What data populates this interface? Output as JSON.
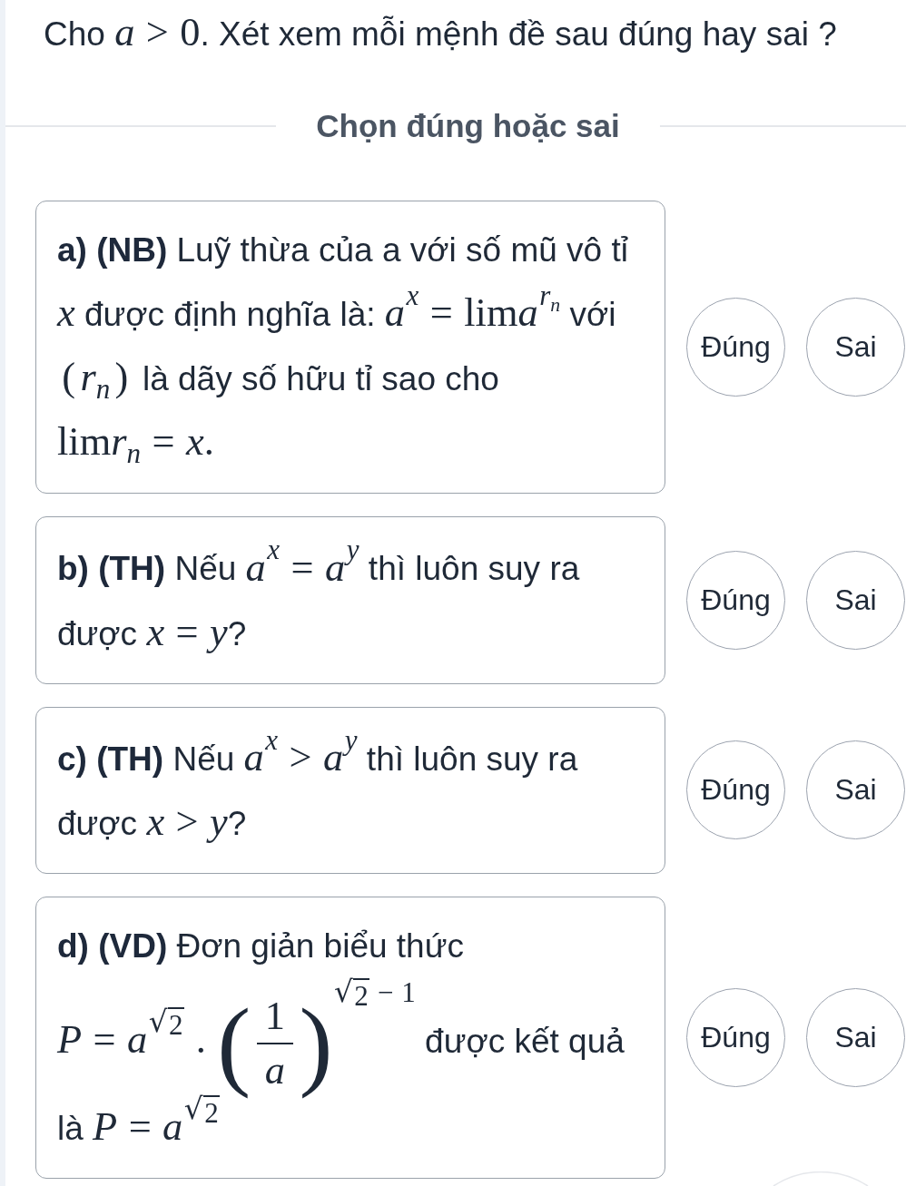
{
  "question": {
    "segments": [
      {
        "kind": "text",
        "text": "Cho "
      },
      {
        "kind": "math",
        "nodes": [
          {
            "kind": "var",
            "text": "a"
          },
          {
            "kind": "rel",
            "text": ">"
          },
          {
            "kind": "text",
            "text": "0"
          }
        ]
      },
      {
        "kind": "text",
        "text": ". Xét xem mỗi mệnh đề sau đúng hay sai ?"
      }
    ]
  },
  "instruction": "Chọn đúng hoặc sai",
  "statements": [
    {
      "segments": [
        {
          "kind": "label",
          "text": "a) (NB)"
        },
        {
          "kind": "text",
          "text": " Luỹ thừa của a với số mũ vô tỉ "
        },
        {
          "kind": "math",
          "nodes": [
            {
              "kind": "var",
              "text": "x"
            }
          ]
        },
        {
          "kind": "text",
          "text": " được định nghĩa là: "
        },
        {
          "kind": "math",
          "nodes": [
            {
              "kind": "sup",
              "base": [
                {
                  "kind": "var",
                  "text": "a"
                }
              ],
              "exp": [
                {
                  "kind": "var",
                  "text": "x"
                }
              ]
            },
            {
              "kind": "rel",
              "text": "="
            },
            {
              "kind": "text",
              "text": "lim"
            },
            {
              "kind": "sup",
              "base": [
                {
                  "kind": "var",
                  "text": "a"
                }
              ],
              "exp": [
                {
                  "kind": "sub",
                  "base": [
                    {
                      "kind": "var",
                      "text": "r"
                    }
                  ],
                  "idx": [
                    {
                      "kind": "var",
                      "text": "n"
                    }
                  ]
                }
              ]
            }
          ]
        },
        {
          "kind": "text",
          "text": " với "
        },
        {
          "kind": "math",
          "nodes": [
            {
              "kind": "fence",
              "text": "("
            },
            {
              "kind": "sub",
              "base": [
                {
                  "kind": "var",
                  "text": "r"
                }
              ],
              "idx": [
                {
                  "kind": "var",
                  "text": "n"
                }
              ]
            },
            {
              "kind": "fence",
              "text": ")"
            }
          ]
        },
        {
          "kind": "text",
          "text": " là dãy số hữu tỉ sao cho "
        },
        {
          "kind": "math",
          "nodes": [
            {
              "kind": "text",
              "text": "lim"
            },
            {
              "kind": "sub",
              "base": [
                {
                  "kind": "var",
                  "text": "r"
                }
              ],
              "idx": [
                {
                  "kind": "var",
                  "text": "n"
                }
              ]
            },
            {
              "kind": "rel",
              "text": "="
            },
            {
              "kind": "var",
              "text": "x"
            },
            {
              "kind": "text",
              "text": "."
            }
          ]
        }
      ],
      "options": [
        {
          "label": "Đúng",
          "selected": false
        },
        {
          "label": "Sai",
          "selected": false
        }
      ]
    },
    {
      "segments": [
        {
          "kind": "label",
          "text": "b) (TH)"
        },
        {
          "kind": "text",
          "text": " Nếu "
        },
        {
          "kind": "math",
          "nodes": [
            {
              "kind": "sup",
              "base": [
                {
                  "kind": "var",
                  "text": "a"
                }
              ],
              "exp": [
                {
                  "kind": "var",
                  "text": "x"
                }
              ]
            },
            {
              "kind": "rel",
              "text": "="
            },
            {
              "kind": "sup",
              "base": [
                {
                  "kind": "var",
                  "text": "a"
                }
              ],
              "exp": [
                {
                  "kind": "var",
                  "text": "y"
                }
              ]
            }
          ]
        },
        {
          "kind": "text",
          "text": " thì luôn suy ra được "
        },
        {
          "kind": "math",
          "nodes": [
            {
              "kind": "var",
              "text": "x"
            },
            {
              "kind": "rel",
              "text": "="
            },
            {
              "kind": "var",
              "text": "y"
            }
          ]
        },
        {
          "kind": "text",
          "text": "?"
        }
      ],
      "options": [
        {
          "label": "Đúng",
          "selected": false
        },
        {
          "label": "Sai",
          "selected": false
        }
      ]
    },
    {
      "segments": [
        {
          "kind": "label",
          "text": "c) (TH)"
        },
        {
          "kind": "text",
          "text": " Nếu "
        },
        {
          "kind": "math",
          "nodes": [
            {
              "kind": "sup",
              "base": [
                {
                  "kind": "var",
                  "text": "a"
                }
              ],
              "exp": [
                {
                  "kind": "var",
                  "text": "x"
                }
              ]
            },
            {
              "kind": "rel",
              "text": ">"
            },
            {
              "kind": "sup",
              "base": [
                {
                  "kind": "var",
                  "text": "a"
                }
              ],
              "exp": [
                {
                  "kind": "var",
                  "text": "y"
                }
              ]
            }
          ]
        },
        {
          "kind": "text",
          "text": " thì luôn suy ra được "
        },
        {
          "kind": "math",
          "nodes": [
            {
              "kind": "var",
              "text": "x"
            },
            {
              "kind": "rel",
              "text": ">"
            },
            {
              "kind": "var",
              "text": "y"
            }
          ]
        },
        {
          "kind": "text",
          "text": "?"
        }
      ],
      "options": [
        {
          "label": "Đúng",
          "selected": false
        },
        {
          "label": "Sai",
          "selected": false
        }
      ]
    },
    {
      "segments": [
        {
          "kind": "label",
          "text": "d) (VD)"
        },
        {
          "kind": "text",
          "text": " Đơn giản biểu thức "
        },
        {
          "kind": "math",
          "nodes": [
            {
              "kind": "var",
              "text": "P"
            },
            {
              "kind": "rel",
              "text": "="
            },
            {
              "kind": "sup",
              "base": [
                {
                  "kind": "var",
                  "text": "a"
                }
              ],
              "exp": [
                {
                  "kind": "sqrt",
                  "sign": "√",
                  "body": [
                    {
                      "kind": "text",
                      "text": "2"
                    }
                  ]
                }
              ]
            },
            {
              "kind": "rel",
              "text": "."
            },
            {
              "kind": "sup",
              "base": [
                {
                  "kind": "big",
                  "open": "(",
                  "close": ")",
                  "body": [
                    {
                      "kind": "frac",
                      "num": [
                        {
                          "kind": "text",
                          "text": "1"
                        }
                      ],
                      "den": [
                        {
                          "kind": "var",
                          "text": "a"
                        }
                      ]
                    }
                  ]
                }
              ],
              "exp": [
                {
                  "kind": "sqrt",
                  "sign": "√",
                  "body": [
                    {
                      "kind": "text",
                      "text": "2"
                    }
                  ]
                },
                {
                  "kind": "rel",
                  "text": "−"
                },
                {
                  "kind": "text",
                  "text": "1"
                }
              ]
            }
          ]
        },
        {
          "kind": "text",
          "text": " được kết quả là "
        },
        {
          "kind": "math",
          "nodes": [
            {
              "kind": "var",
              "text": "P"
            },
            {
              "kind": "rel",
              "text": "="
            },
            {
              "kind": "sup",
              "base": [
                {
                  "kind": "var",
                  "text": "a"
                }
              ],
              "exp": [
                {
                  "kind": "sqrt",
                  "sign": "√",
                  "body": [
                    {
                      "kind": "text",
                      "text": "2"
                    }
                  ]
                }
              ]
            }
          ]
        }
      ],
      "options": [
        {
          "label": "Đúng",
          "selected": false
        },
        {
          "label": "Sai",
          "selected": false
        }
      ]
    }
  ]
}
